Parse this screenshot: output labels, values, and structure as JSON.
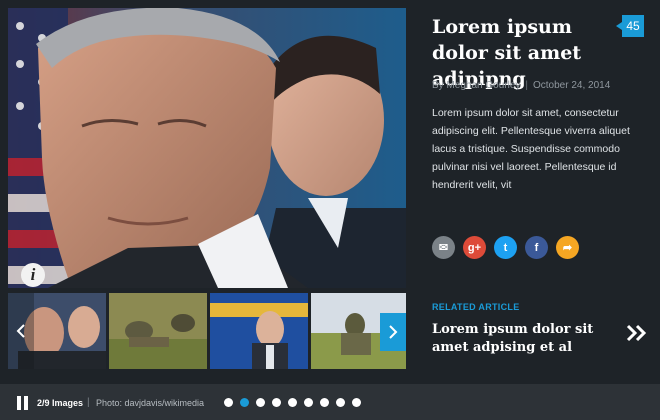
{
  "article": {
    "headline": "Lorem ipsum dolor sit amet adipipng",
    "comment_count": "45",
    "author": "By Meghan Gourley",
    "separator": "|",
    "date": "October 24, 2014",
    "body": "Lorem ipsum dolor sit amet, consectetur adipiscing elit. Pellentesque viverra aliquet lacus a tristique. Suspendisse commodo pulvinar nisi vel laoreet. Pellentesque id hendrerit velit, vit"
  },
  "share": [
    {
      "icon": "email-icon",
      "glyph": "✉",
      "color": "#7b8288"
    },
    {
      "icon": "google-plus-icon",
      "glyph": "g+",
      "color": "#dd4b39"
    },
    {
      "icon": "twitter-icon",
      "glyph": "t",
      "color": "#1da1f2"
    },
    {
      "icon": "facebook-icon",
      "glyph": "f",
      "color": "#3b5998"
    },
    {
      "icon": "share-arrow-icon",
      "glyph": "➦",
      "color": "#f5a623"
    }
  ],
  "related": {
    "label": "RELATED ARTICLE",
    "title": "Lorem ipsum dolor sit amet adpising et al"
  },
  "gallery": {
    "count": "2/9 Images",
    "separator": "|",
    "credit": "Photo: davjdavis/wikimedia",
    "total_dots": 9,
    "active_dot": 1
  },
  "colors": {
    "accent": "#1a9bd7",
    "background": "#1e2328",
    "bar": "#2d3237"
  }
}
